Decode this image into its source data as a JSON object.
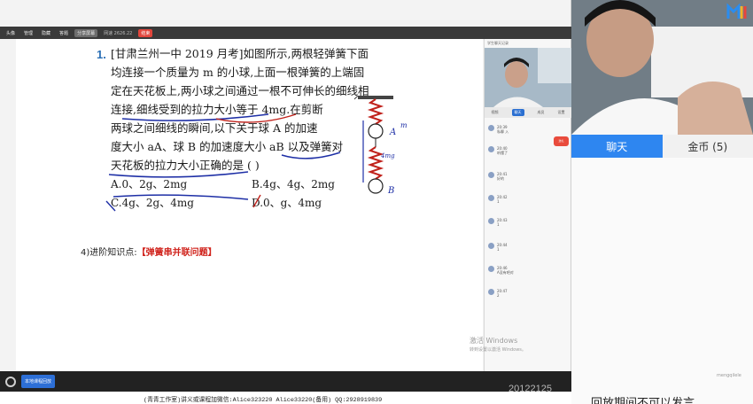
{
  "topbar": {
    "items": [
      "头像",
      "管理",
      "隐藏",
      "答题",
      "分享屏幕",
      "结束"
    ],
    "stat": "网速 2626.22"
  },
  "slide": {
    "question_number": "1.",
    "lines": [
      "[甘肃兰州一中 2019 月考]如图所示,两根轻弹簧下面",
      "均连接一个质量为 m 的小球,上面一根弹簧的上端固",
      "定在天花板上,两小球之间通过一根不可伸长的细线相",
      "连接,细线受到的拉力大小等于 4mg.在剪断",
      "两球之间细线的瞬间,以下关于球 A 的加速",
      "度大小 aA、球 B 的加速度大小 aB 以及弹簧对",
      "天花板的拉力大小正确的是          (     )"
    ],
    "options": {
      "a": "A.0、2g、2mg",
      "b": "B.4g、4g、2mg",
      "c": "C.4g、2g、4mg",
      "d": "D.0、g、4mg"
    },
    "knowledge_point_prefix": "4)进阶知识点:",
    "knowledge_point_highlight": "【弹簧串并联问题】",
    "handwriting": {
      "label_a": "A",
      "label_b": "B",
      "m": "m",
      "mg": "4mg"
    }
  },
  "statusbar": {
    "button_label": "本地课程回放"
  },
  "chat_column": {
    "header": "学生聊天记录",
    "tabs": [
      "视频",
      "聊天",
      "成员",
      "设置"
    ],
    "messages": [
      {
        "time": "20:39",
        "text": "私聊 入"
      },
      {
        "time": "20:40",
        "text": "听懂了"
      },
      {
        "time": "20:41",
        "text": "好的"
      },
      {
        "time": "20:42",
        "text": "1"
      },
      {
        "time": "20:43",
        "text": "1"
      },
      {
        "time": "20:44",
        "text": "1"
      },
      {
        "time": "20:46",
        "text": "A没有吧对"
      },
      {
        "time": "20:47",
        "text": "2"
      }
    ],
    "badge": "送礼",
    "watermark_1": "激活 Windows",
    "watermark_2": "转到设置以激活 Windows。"
  },
  "right_panel": {
    "tab_chat": "聊天",
    "tab_coins": "金币 (5)",
    "watermark": "mengqilele",
    "bottom_note": "回放期间不可以发言"
  },
  "footer": {
    "text": "(青青工作室)讲义或课程加微信:Alice323220 Alice33220(备用) QQ:2928919839",
    "date": "20122125"
  },
  "colors": {
    "accent_blue": "#2e86f0",
    "question_blue": "#2a6fb5",
    "highlight_red": "#d0231c"
  }
}
